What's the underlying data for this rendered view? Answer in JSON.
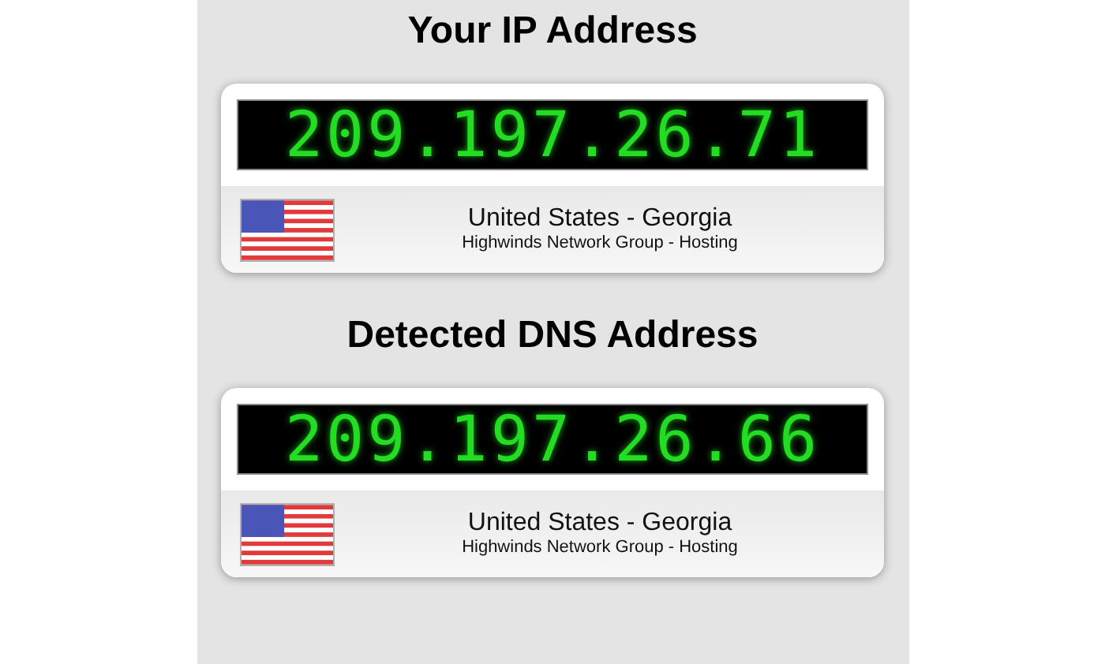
{
  "sections": [
    {
      "heading": "Your IP Address",
      "ip": "209.197.26.71",
      "location": "United States - Georgia",
      "provider": "Highwinds Network Group - Hosting"
    },
    {
      "heading": "Detected DNS Address",
      "ip": "209.197.26.66",
      "location": "United States - Georgia",
      "provider": "Highwinds Network Group - Hosting"
    }
  ]
}
